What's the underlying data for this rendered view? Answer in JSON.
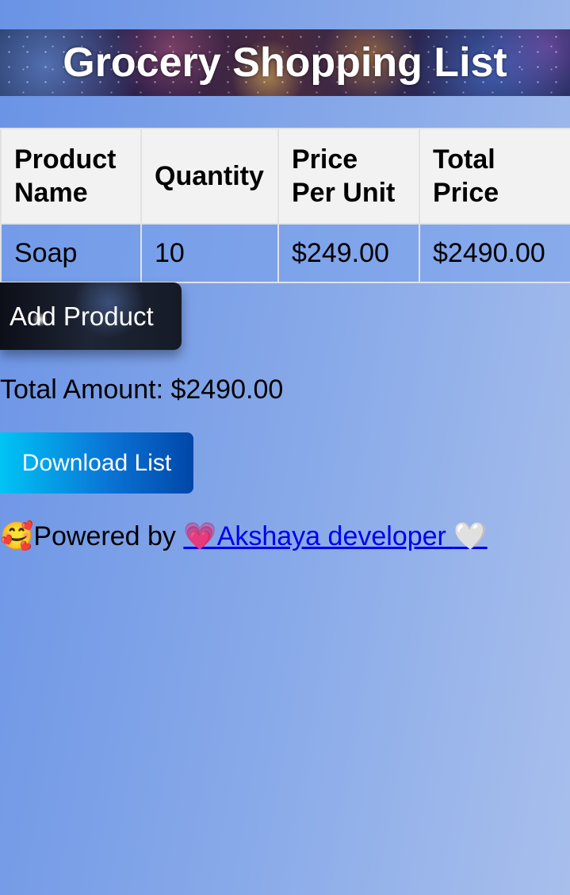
{
  "header": {
    "title": "Grocery Shopping List"
  },
  "table": {
    "columns": [
      "Product Name",
      "Quantity",
      "Price Per Unit",
      "Total Price"
    ],
    "rows": [
      {
        "name": "Soap",
        "quantity": "10",
        "price": "$249.00",
        "total": "$2490.00"
      }
    ]
  },
  "actions": {
    "add_label": "Add Product",
    "download_label": "Download List"
  },
  "summary": {
    "total_label": "Total Amount: $2490.00"
  },
  "footer": {
    "emoji_lead": "🥰",
    "prefix": "Powered by ",
    "link_emoji_start": "💗",
    "link_text": "Akshaya developer ",
    "link_emoji_end": "🤍"
  },
  "colors": {
    "background_start": "#6a93e6",
    "background_end": "#a8bfec",
    "header_cell": "#f2f2f2",
    "download_button": "#0a75d6",
    "link": "#0000ee"
  },
  "icons": {
    "smiling_face_with_hearts": "footer-emoji-icon",
    "growing_heart": "heart-pink-icon",
    "white_heart": "heart-white-icon"
  }
}
